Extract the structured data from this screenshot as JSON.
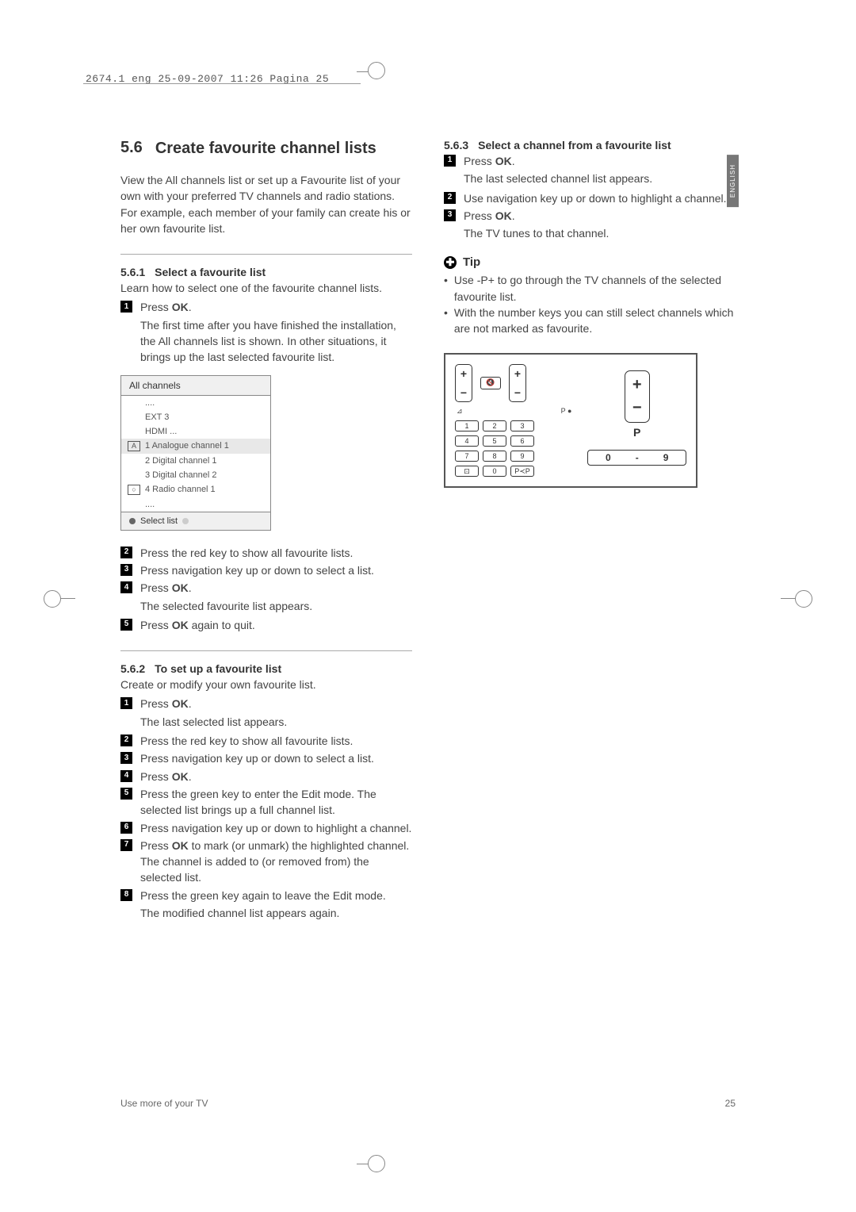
{
  "header": {
    "crop_info": "2674.1 eng  25-09-2007  11:26  Pagina 25"
  },
  "lang_tab": "ENGLISH",
  "section": {
    "number": "5.6",
    "title": "Create favourite channel lists",
    "intro": "View the All channels list or set up a Favourite list of your own with your preferred TV channels and radio stations. For example, each member of your family can create his or her own favourite list."
  },
  "sub561": {
    "num": "5.6.1",
    "title": "Select a favourite list",
    "intro": "Learn how to select one of the favourite channel lists.",
    "steps": [
      {
        "n": "1",
        "text_pre": "Press ",
        "bold": "OK",
        "text_post": "."
      },
      {
        "desc": "The first time after you have finished the installation, the All channels list is shown. In other situations, it brings up the last selected favourite list."
      }
    ],
    "channel_list": {
      "title": "All channels",
      "rows": [
        {
          "icon": "",
          "text": "...."
        },
        {
          "icon": "",
          "text": "EXT 3"
        },
        {
          "icon": "",
          "text": "HDMI ..."
        },
        {
          "icon": "A",
          "text": "1 Analogue channel 1",
          "highlight": true
        },
        {
          "icon": "",
          "text": "2 Digital channel 1"
        },
        {
          "icon": "",
          "text": "3 Digital channel 2"
        },
        {
          "icon": "radio",
          "text": "4 Radio channel 1"
        },
        {
          "icon": "",
          "text": "...."
        }
      ],
      "footer": "Select list"
    },
    "steps2": [
      {
        "n": "2",
        "text": "Press the red key to show all favourite lists."
      },
      {
        "n": "3",
        "text": "Press navigation key up or down to select a list."
      },
      {
        "n": "4",
        "text_pre": "Press ",
        "bold": "OK",
        "text_post": "."
      },
      {
        "desc": "The selected favourite list appears."
      },
      {
        "n": "5",
        "text_pre": "Press ",
        "bold": "OK",
        "text_post": " again to quit."
      }
    ]
  },
  "sub562": {
    "num": "5.6.2",
    "title": "To set up a favourite list",
    "intro": "Create or modify your own favourite list.",
    "steps": [
      {
        "n": "1",
        "text_pre": "Press ",
        "bold": "OK",
        "text_post": "."
      },
      {
        "desc": "The last selected list appears."
      },
      {
        "n": "2",
        "text": "Press the red key to show all favourite lists."
      },
      {
        "n": "3",
        "text": "Press navigation key up or down to select a list."
      },
      {
        "n": "4",
        "text_pre": "Press ",
        "bold": "OK",
        "text_post": "."
      },
      {
        "n": "5",
        "text": "Press the green key to enter the Edit mode. The selected list brings up a full channel list."
      },
      {
        "n": "6",
        "text": "Press navigation key up or down to highlight a channel."
      },
      {
        "n": "7",
        "text_pre": "Press ",
        "bold": "OK",
        "text_post": " to mark (or unmark) the highlighted channel. The channel is added to (or removed from) the selected list."
      },
      {
        "n": "8",
        "text": "Press the green key again to leave the Edit mode."
      },
      {
        "desc": "The modified channel list appears again."
      }
    ]
  },
  "sub563": {
    "num": "5.6.3",
    "title": "Select a channel from a favourite list",
    "steps": [
      {
        "n": "1",
        "text_pre": "Press ",
        "bold": "OK",
        "text_post": "."
      },
      {
        "desc": "The last selected channel list appears."
      },
      {
        "n": "2",
        "text": "Use navigation key up or down to highlight a channel."
      },
      {
        "n": "3",
        "text_pre": "Press ",
        "bold": "OK",
        "text_post": "."
      },
      {
        "desc": "The TV tunes to that channel."
      }
    ]
  },
  "tip": {
    "label": "Tip",
    "items": [
      "Use -P+ to go through the TV channels of the selected favourite list.",
      "With the number keys you can still select channels which are not marked as favourite."
    ]
  },
  "remote": {
    "p_label": "P",
    "range": [
      "0",
      "-",
      "9"
    ],
    "nums": [
      "1",
      "2",
      "3",
      "4",
      "5",
      "6",
      "7",
      "8",
      "9",
      "⊡",
      "0",
      "P≺P"
    ]
  },
  "footer": {
    "left": "Use more of your TV",
    "right": "25"
  }
}
